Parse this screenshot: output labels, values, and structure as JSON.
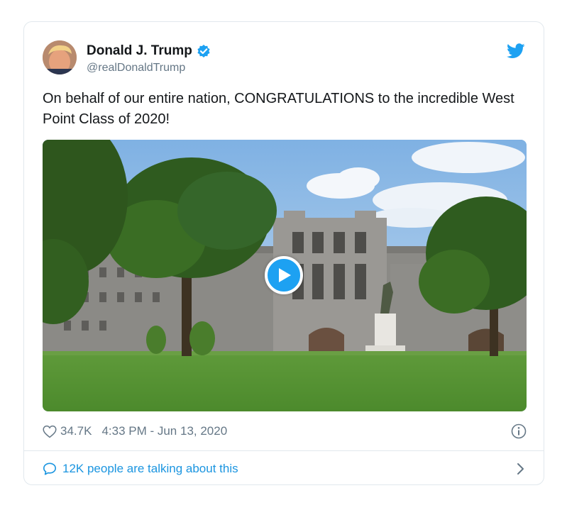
{
  "tweet": {
    "author": {
      "display_name": "Donald J. Trump",
      "handle": "@realDonaldTrump",
      "verified": true
    },
    "text": "On behalf of our entire nation, CONGRATULATIONS to the incredible West Point Class of 2020!",
    "media": {
      "type": "video"
    },
    "likes": "34.7K",
    "timestamp": "4:33 PM - Jun 13, 2020",
    "talking": "12K people are talking about this"
  },
  "icons": {
    "brand": "twitter-bird-icon",
    "verified": "verified-badge-icon",
    "like": "heart-icon",
    "info": "info-icon",
    "reply": "comment-bubble-icon",
    "more": "chevron-right-icon",
    "play": "play-icon"
  },
  "colors": {
    "accent": "#1da1f2",
    "link": "#1b95e0",
    "muted": "#657786",
    "text": "#14171a",
    "border": "#e1e8ed"
  }
}
